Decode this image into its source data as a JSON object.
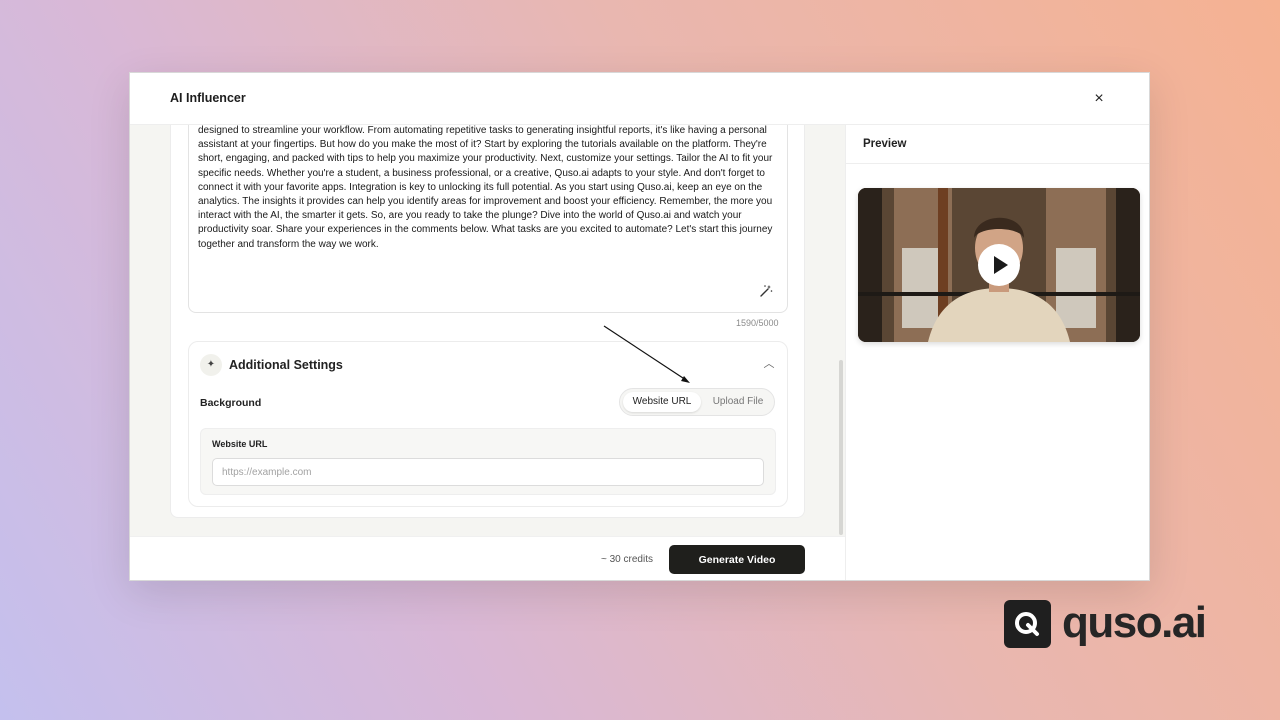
{
  "modal": {
    "title": "AI Influencer",
    "close_label": "×"
  },
  "script": {
    "text": "designed to streamline your workflow. From automating repetitive tasks to generating insightful reports, it's like having a personal assistant at your fingertips. But how do you make the most of it? Start by exploring the tutorials available on the platform. They're short, engaging, and packed with tips to help you maximize your productivity. Next, customize your settings. Tailor the AI to fit your specific needs. Whether you're a student, a business professional, or a creative, Quso.ai adapts to your style. And don't forget to connect it with your favorite apps. Integration is key to unlocking its full potential. As you start using Quso.ai, keep an eye on the analytics. The insights it provides can help you identify areas for improvement and boost your efficiency. Remember, the more you interact with the AI, the smarter it gets. So, are you ready to take the plunge? Dive into the world of Quso.ai and watch your productivity soar. Share your experiences in the comments below. What tasks are you excited to automate? Let's start this journey together and transform the way we work.",
    "char_count": "1590/5000",
    "magic_icon": "magic-wand-icon"
  },
  "additional_settings": {
    "title": "Additional Settings",
    "background_label": "Background",
    "toggle_options": [
      "Website URL",
      "Upload File"
    ],
    "selected_option": "Website URL",
    "url_label": "Website URL",
    "url_value": "",
    "url_placeholder": "https://example.com"
  },
  "footer": {
    "credits": "~ 30 credits",
    "generate_label": "Generate Video"
  },
  "preview": {
    "title": "Preview"
  },
  "brand": {
    "logo_text": "quso.ai"
  },
  "colors": {
    "primary_button": "#1f1f1c",
    "background_gradient": [
      "#c4c0ee",
      "#f5b292"
    ]
  }
}
